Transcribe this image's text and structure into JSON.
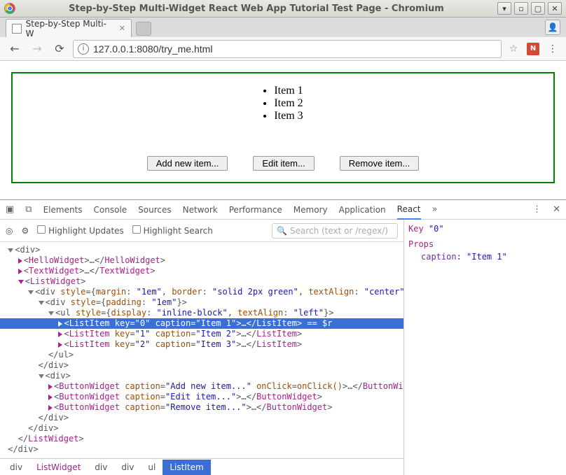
{
  "window": {
    "title": "Step-by-Step Multi-Widget React Web App Tutorial Test Page - Chromium"
  },
  "tab": {
    "label": "Step-by-Step Multi-W"
  },
  "address": {
    "url": "127.0.0.1:8080/try_me.html"
  },
  "page": {
    "items": [
      "Item 1",
      "Item 2",
      "Item 3"
    ],
    "buttons": {
      "add": "Add new item...",
      "edit": "Edit item...",
      "remove": "Remove item..."
    }
  },
  "devtools": {
    "tabs": [
      "Elements",
      "Console",
      "Sources",
      "Network",
      "Performance",
      "Memory",
      "Application",
      "React"
    ],
    "active_tab": "React",
    "highlight_updates": "Highlight Updates",
    "highlight_search": "Highlight Search",
    "search_placeholder": "Search (text or /regex/)",
    "side": {
      "key_label": "Key",
      "key_value": "\"0\"",
      "props_label": "Props",
      "prop_name": "caption",
      "prop_value": "\"Item 1\""
    },
    "breadcrumb": [
      "div",
      "ListWidget",
      "div",
      "div",
      "ul",
      "ListItem"
    ],
    "tree": {
      "l1": "<div>",
      "l2a": "<",
      "l2b": "HelloWidget",
      "l2c": ">…</",
      "l2d": "HelloWidget",
      "l2e": ">",
      "l3a": "<",
      "l3b": "TextWidget",
      "l3c": ">…</",
      "l3d": "TextWidget",
      "l3e": ">",
      "l4a": "<",
      "l4b": "ListWidget",
      "l4c": ">",
      "l5a": "<div ",
      "l5b": "style",
      "l5c": "={",
      "l5m": "margin",
      "l5mv": "\"1em\"",
      "l5bd": "border",
      "l5bdv": "\"solid 2px green\"",
      "l5ta": "textAlign",
      "l5tav": "\"center\"",
      "l5e": "}>",
      "l6a": "<div ",
      "l6b": "style",
      "l6c": "={",
      "l6p": "padding",
      "l6pv": "\"1em\"",
      "l6e": "}>",
      "l7a": "<ul ",
      "l7b": "style",
      "l7c": "={",
      "l7d": "display",
      "l7dv": "\"inline-block\"",
      "l7ta": "textAlign",
      "l7tav": "\"left\"",
      "l7e": "}>",
      "l8a": "<",
      "l8b": "ListItem",
      "l8k": "key",
      "l8kv": "\"0\"",
      "l8cp": "caption",
      "l8cpv": "\"Item 1\"",
      "l8c": ">…</",
      "l8d": "ListItem",
      "l8e": "> == $r",
      "l9a": "<",
      "l9b": "ListItem",
      "l9k": "key",
      "l9kv": "\"1\"",
      "l9cp": "caption",
      "l9cpv": "\"Item 2\"",
      "l9c": ">…</",
      "l9d": "ListItem",
      "l9e": ">",
      "l10a": "<",
      "l10b": "ListItem",
      "l10k": "key",
      "l10kv": "\"2\"",
      "l10cp": "caption",
      "l10cpv": "\"Item 3\"",
      "l10c": ">…</",
      "l10d": "ListItem",
      "l10e": ">",
      "l11": "</ul>",
      "l12": "</div>",
      "l13": "<div>",
      "l14a": "<",
      "l14b": "ButtonWidget",
      "l14cp": "caption",
      "l14cpv": "\"Add new item...\"",
      "l14oc": "onClick",
      "l14ocv": "onClick()",
      "l14c": ">…</",
      "l14d": "ButtonWidget",
      "l14e": ">",
      "l15a": "<",
      "l15b": "ButtonWidget",
      "l15cp": "caption",
      "l15cpv": "\"Edit item...\"",
      "l15c": ">…</",
      "l15d": "ButtonWidget",
      "l15e": ">",
      "l16a": "<",
      "l16b": "ButtonWidget",
      "l16cp": "caption",
      "l16cpv": "\"Remove item...\"",
      "l16c": ">…</",
      "l16d": "ButtonWidget",
      "l16e": ">",
      "l17": "</div>",
      "l18": "</div>",
      "l19a": "</",
      "l19b": "ListWidget",
      "l19c": ">",
      "l20": "</div>"
    }
  }
}
